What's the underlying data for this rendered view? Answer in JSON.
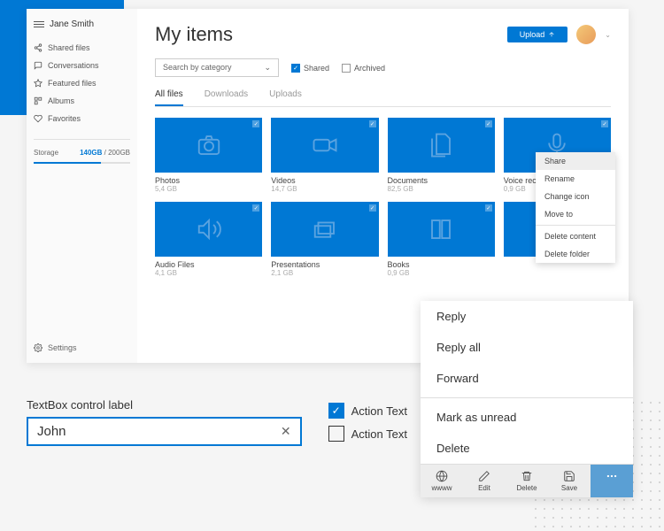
{
  "user": {
    "name": "Jane Smith"
  },
  "sidebar": {
    "items": [
      {
        "label": "Shared files"
      },
      {
        "label": "Conversations"
      },
      {
        "label": "Featured files"
      },
      {
        "label": "Albums"
      },
      {
        "label": "Favorites"
      }
    ],
    "storage": {
      "label": "Storage",
      "used": "140GB",
      "total": "200GB"
    },
    "settings": "Settings"
  },
  "header": {
    "title": "My items",
    "upload_label": "Upload"
  },
  "filters": {
    "category_placeholder": "Search by category",
    "shared_label": "Shared",
    "archived_label": "Archived"
  },
  "tabs": [
    {
      "label": "All files"
    },
    {
      "label": "Downloads"
    },
    {
      "label": "Uploads"
    }
  ],
  "folders": [
    {
      "name": "Photos",
      "size": "5,4 GB"
    },
    {
      "name": "Videos",
      "size": "14,7 GB"
    },
    {
      "name": "Documents",
      "size": "82,5 GB"
    },
    {
      "name": "Voice recordings",
      "size": "0,9 GB"
    },
    {
      "name": "Audio Files",
      "size": "4,1 GB"
    },
    {
      "name": "Presentations",
      "size": "2,1 GB"
    },
    {
      "name": "Books",
      "size": "0,9 GB"
    },
    {
      "name": "",
      "size": ""
    }
  ],
  "context_menu": {
    "items": [
      "Share",
      "Rename",
      "Change icon",
      "Move to",
      "Delete content",
      "Delete folder"
    ]
  },
  "mail_menu": {
    "items": [
      "Reply",
      "Reply all",
      "Forward",
      "Mark as unread",
      "Delete"
    ],
    "tools": [
      "wwww",
      "Edit",
      "Delete",
      "Save"
    ]
  },
  "form": {
    "textbox_label": "TextBox control label",
    "textbox_value": "John",
    "action_text": "Action Text"
  }
}
